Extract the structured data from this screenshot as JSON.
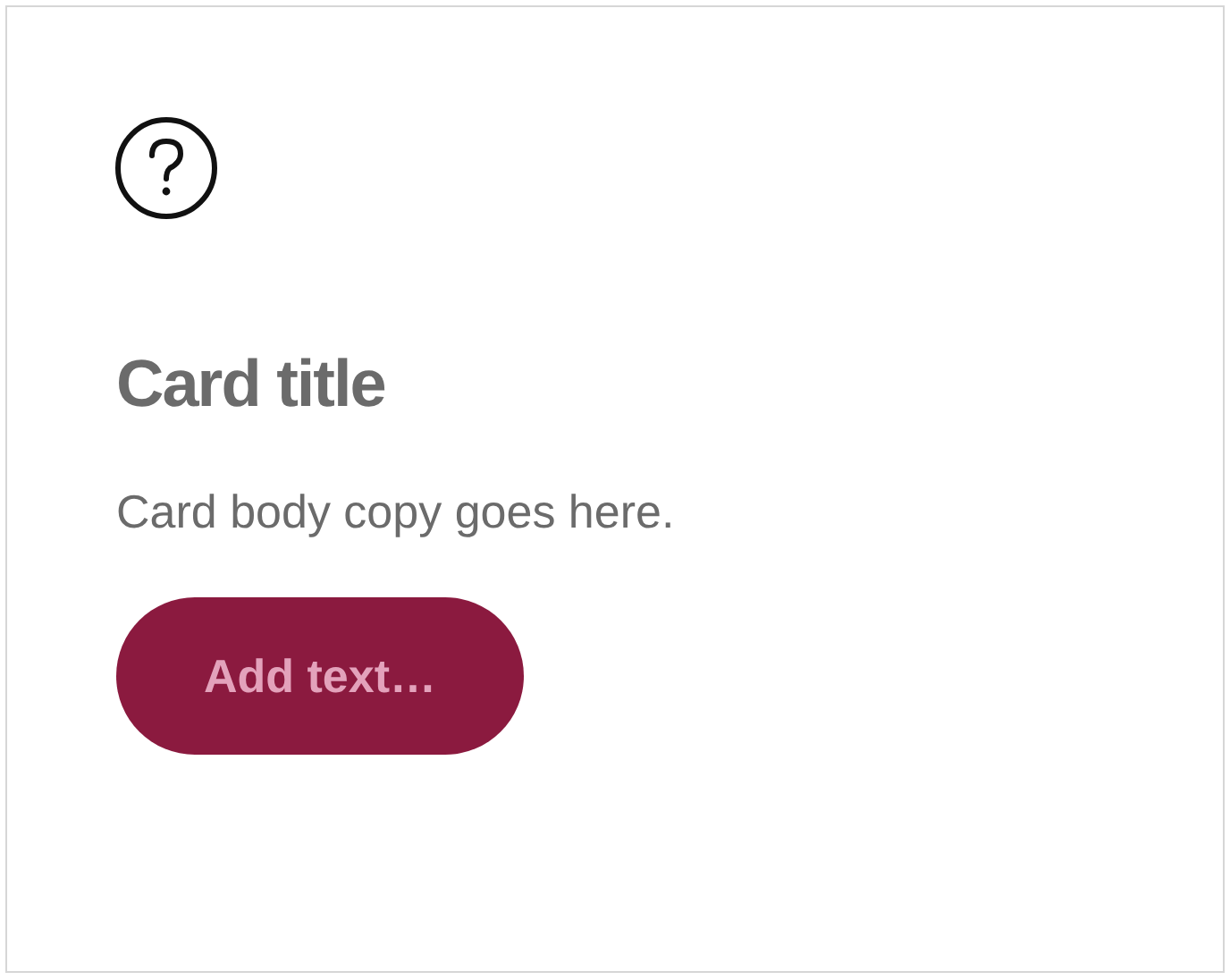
{
  "card": {
    "title": "Card title",
    "body": "Card body copy goes here.",
    "button": {
      "label": "Add text…"
    }
  }
}
